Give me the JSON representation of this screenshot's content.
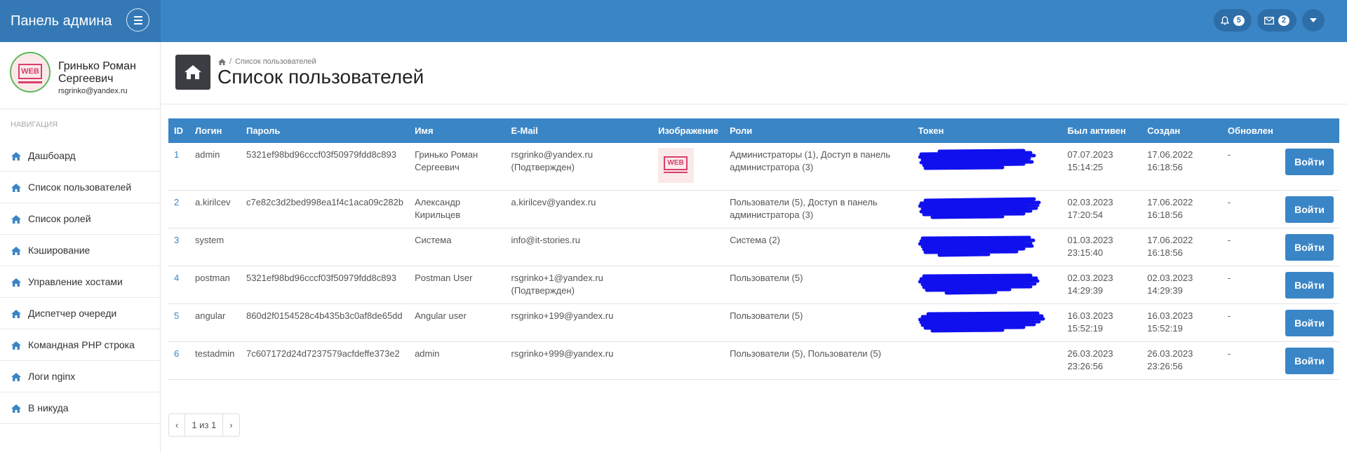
{
  "app": {
    "brand_title": "Панель админа",
    "notifications_count": "5",
    "messages_count": "2",
    "accent_color": "#3a85c6"
  },
  "profile": {
    "name": "Гринько Роман Сергеевич",
    "email": "rsgrinko@yandex.ru",
    "logo_text": "WEB"
  },
  "nav": {
    "header": "НАВИГАЦИЯ",
    "items": [
      {
        "label": "Дашбоард",
        "icon": "home-icon"
      },
      {
        "label": "Список пользователей",
        "icon": "home-icon"
      },
      {
        "label": "Список ролей",
        "icon": "home-icon"
      },
      {
        "label": "Кэширование",
        "icon": "home-icon"
      },
      {
        "label": "Управление хостами",
        "icon": "home-icon"
      },
      {
        "label": "Диспетчер очереди",
        "icon": "home-icon"
      },
      {
        "label": "Командная PHP строка",
        "icon": "home-icon"
      },
      {
        "label": "Логи nginx",
        "icon": "home-icon"
      },
      {
        "label": "В никуда",
        "icon": "home-icon"
      }
    ]
  },
  "page": {
    "breadcrumb_current": "Список пользователей",
    "title": "Список пользователей"
  },
  "table": {
    "headers": [
      "ID",
      "Логин",
      "Пароль",
      "Имя",
      "E-Mail",
      "Изображение",
      "Роли",
      "Токен",
      "Был активен",
      "Создан",
      "Обновлен"
    ],
    "action_label": "Войти",
    "rows": [
      {
        "id": "1",
        "login": "admin",
        "password": "5321ef98bd96cccf03f50979fdd8c893",
        "name": "Гринько Роман Сергеевич",
        "email": "rsgrinko@yandex.ru (Подтвержден)",
        "has_image": true,
        "roles": "Администраторы (1), Доступ в панель администратора (3)",
        "token_redacted": true,
        "active_date": "07.07.2023",
        "active_time": "15:14:25",
        "created_date": "17.06.2022",
        "created_time": "16:18:56",
        "updated": "-"
      },
      {
        "id": "2",
        "login": "a.kirilcev",
        "password": "c7e82c3d2bed998ea1f4c1aca09c282b",
        "name": "Александр Кирильцев",
        "email": "a.kirilcev@yandex.ru",
        "has_image": false,
        "roles": "Пользователи (5), Доступ в панель администратора (3)",
        "token_redacted": true,
        "active_date": "02.03.2023",
        "active_time": "17:20:54",
        "created_date": "17.06.2022",
        "created_time": "16:18:56",
        "updated": "-"
      },
      {
        "id": "3",
        "login": "system",
        "password": "",
        "name": "Система",
        "email": "info@it-stories.ru",
        "has_image": false,
        "roles": "Система (2)",
        "token_redacted": true,
        "active_date": "01.03.2023",
        "active_time": "23:15:40",
        "created_date": "17.06.2022",
        "created_time": "16:18:56",
        "updated": "-"
      },
      {
        "id": "4",
        "login": "postman",
        "password": "5321ef98bd96cccf03f50979fdd8c893",
        "name": "Postman User",
        "email": "rsgrinko+1@yandex.ru (Подтвержден)",
        "has_image": false,
        "roles": "Пользователи (5)",
        "token_redacted": true,
        "active_date": "02.03.2023",
        "active_time": "14:29:39",
        "created_date": "02.03.2023",
        "created_time": "14:29:39",
        "updated": "-"
      },
      {
        "id": "5",
        "login": "angular",
        "password": "860d2f0154528c4b435b3c0af8de65dd",
        "name": "Angular user",
        "email": "rsgrinko+199@yandex.ru",
        "has_image": false,
        "roles": "Пользователи (5)",
        "token_redacted": true,
        "active_date": "16.03.2023",
        "active_time": "15:52:19",
        "created_date": "16.03.2023",
        "created_time": "15:52:19",
        "updated": "-"
      },
      {
        "id": "6",
        "login": "testadmin",
        "password": "7c607172d24d7237579acfdeffe373e2",
        "name": "admin",
        "email": "rsgrinko+999@yandex.ru",
        "has_image": false,
        "roles": "Пользователи (5), Пользователи (5)",
        "token_redacted": false,
        "active_date": "26.03.2023",
        "active_time": "23:26:56",
        "created_date": "26.03.2023",
        "created_time": "23:26:56",
        "updated": "-"
      }
    ]
  },
  "pagination": {
    "prev": "‹",
    "info": "1 из 1",
    "next": "›"
  }
}
